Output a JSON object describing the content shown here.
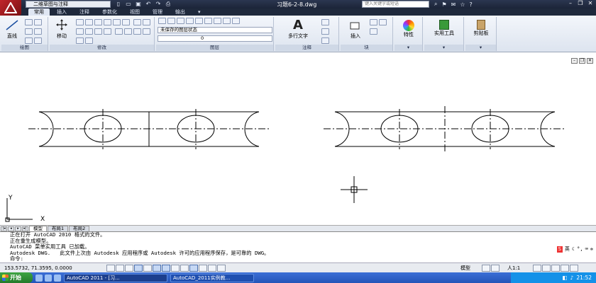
{
  "titlebar": {
    "workspace": "二维草图与注释",
    "document": "习题6-2-8.dwg",
    "search_placeholder": "键入关键字或短语"
  },
  "ribbon_tabs": [
    "常用",
    "插入",
    "注释",
    "参数化",
    "视图",
    "管理",
    "输出"
  ],
  "ribbon": {
    "line_label": "直线",
    "move_label": "移动",
    "layer_state": "未保存的图层状态",
    "layer_current": "0",
    "mtext_label": "多行文字",
    "insert_label": "插入",
    "properties_label": "特性",
    "utilities_label": "实用工具",
    "clipboard_label": "剪贴板",
    "panels": {
      "draw": "绘图",
      "modify": "修改",
      "layers": "图层",
      "annotation": "注释",
      "block": "块"
    }
  },
  "layout_tabs": [
    "模型",
    "布局1",
    "布局2"
  ],
  "command": {
    "lines": [
      "正在打开 AutoCAD 2010 格式的文件。",
      "正在重生成模型。",
      "AutoCAD 菜单实用工具 已加载。",
      "Autodesk DWG.   此文件上次由 Autodesk 应用程序或 Autodesk 许可的应用程序保存，是可靠的 DWG。"
    ],
    "prompt": "命令:"
  },
  "ime": {
    "label": "英"
  },
  "status": {
    "coords": "153.5732, 71.3595, 0.0000",
    "model_label": "模型",
    "scale": "人1:1"
  },
  "taskbar": {
    "start": "开始",
    "tasks": [
      "AutoCAD 2011 - [习...",
      "AutoCAD_2011实例教..."
    ],
    "time": "21:52"
  },
  "ucs": {
    "x": "X",
    "y": "Y"
  }
}
